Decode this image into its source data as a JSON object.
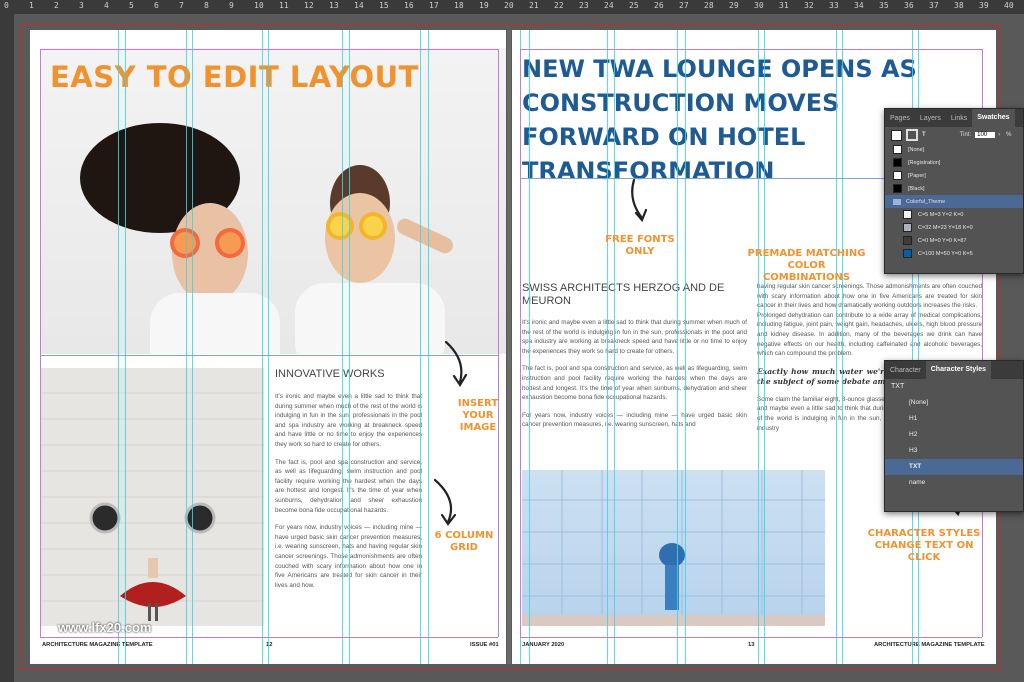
{
  "rulers": {
    "top_ticks": [
      "0",
      "1",
      "2",
      "3",
      "4",
      "5",
      "6",
      "7",
      "8",
      "9",
      "10",
      "11",
      "12",
      "13",
      "14",
      "15",
      "16",
      "17",
      "18",
      "19",
      "20",
      "21",
      "22",
      "23",
      "24",
      "25",
      "26",
      "27",
      "28",
      "29",
      "30",
      "31",
      "32",
      "33",
      "34",
      "35",
      "36",
      "37",
      "38",
      "39",
      "40"
    ]
  },
  "left_page": {
    "headline": "EASY TO EDIT LAYOUT",
    "section_title": "INNOVATIVE WORKS",
    "paragraphs": [
      "It's ironic and maybe even a little sad to think that during summer when much of the rest of the world is indulging in fun in the sun, professionals in the pool and spa industry are working at breakneck speed and have little or no time to enjoy the experiences they work so hard to create for others.",
      "The fact is, pool and spa construction and service, as well as lifeguarding, swim instruction and pool facility require working the hardest when the days are hottest and longest. It's the time of year when sunburns, dehydration and sheer exhaustion become bona fide occupational hazards.",
      "For years now, industry voices — including mine — have urged basic skin cancer prevention measures, i.e. wearing sunscreen, hats and having regular skin cancer screenings. Those admonishments are often couched with scary information about how one in five Americans are treated for skin cancer in their lives and how."
    ],
    "footer_left": "ARCHITECTURE MAGAZINE TEMPLATE",
    "page_number": "12",
    "footer_issue": "ISSUE #01"
  },
  "right_page": {
    "headline": "NEW TWA LOUNGE OPENS AS CONSTRUCTION MOVES FORWARD ON HOTEL TRANSFORMATION",
    "section_title": "SWISS ARCHITECTS HERZOG AND DE MEURON",
    "col1_paragraphs": [
      "It's ironic and maybe even a little sad to think that during summer when much of the rest of the world is indulging in fun in the sun, professionals in the pool and spa industry are working at breakneck speed and have little or no time to enjoy the experiences they work so hard to create for others.",
      "The fact is, pool and spa construction and service, as well as lifeguarding, swim instruction and pool facility require working the hardest when the days are hottest and longest. It's the time of year when sunburns, dehydration and sheer exhaustion become bona fide occupational hazards.",
      "For years now, industry voices — including mine — have urged basic skin cancer prevention measures, i.e. wearing sunscreen, hats and"
    ],
    "col2_paragraphs": [
      "having regular skin cancer screenings. Those admonishments are often couched with scary information about how one in five Americans are treated for skin cancer in their lives and how dramatically working outdoors increases the risks.",
      "Prolonged dehydration can contribute to a wide array of medical complications, including fatigue, joint pain, weight gain, headaches, ulcers, high blood pressure and kidney disease. In addition, many of the beverages we drink can have negative effects on our health, including caffeinated and alcoholic beverages, which can compound the problem."
    ],
    "pull_quote": "Exactly how much water we're supposed to drink is the subject of some debate among medical",
    "col2_tail": "Some claim the familiar eight, 8-ounce glasses a day rule is excessive. It's ironic and maybe even a little sad to think that during summer, when much of the rest of the world is indulging in fun in the sun, professionals in the pool and spa industry",
    "footer_date": "JANUARY 2020",
    "page_number": "13",
    "footer_right": "ARCHITECTURE MAGAZINE TEMPLATE"
  },
  "annotations": {
    "free_fonts": "FREE FONTS ONLY",
    "premade_colors": "PREMADE MATCHING COLOR COMBINATIONS",
    "insert_image": "INSERT YOUR IMAGE",
    "column_grid": "6 COLUMN GRID",
    "char_styles": "CHARACTER STYLES CHANGE TEXT ON CLICK"
  },
  "watermark": "www.lfx20.com",
  "swatches_panel": {
    "tabs": [
      "Pages",
      "Layers",
      "Links",
      "Swatches"
    ],
    "active_tab": "Swatches",
    "tint_label": "Tint:",
    "tint_value": "100",
    "tint_unit": "%",
    "swatches": [
      {
        "name": "[None]",
        "color": "#ffffff"
      },
      {
        "name": "[Registration]",
        "color": "#000000"
      },
      {
        "name": "[Paper]",
        "color": "#ffffff"
      },
      {
        "name": "[Black]",
        "color": "#000000"
      },
      {
        "name": "Colorful_Theme",
        "color": "",
        "group": true
      },
      {
        "name": "C=5 M=3 Y=2 K=0",
        "color": "#f2f3f5"
      },
      {
        "name": "C=32 M=23 Y=18 K=0",
        "color": "#adb3b9"
      },
      {
        "name": "C=0 M=0 Y=0 K=87",
        "color": "#3c3c3c"
      },
      {
        "name": "C=100 M=50 Y=0 K=5",
        "color": "#0060a8"
      }
    ]
  },
  "char_panel": {
    "tabs": [
      "Character",
      "Character Styles"
    ],
    "active_tab": "Character Styles",
    "styles": [
      "[None]",
      "H1",
      "H2",
      "H3",
      "TXT",
      "name"
    ],
    "selected": "TXT",
    "header_label": "TXT"
  }
}
